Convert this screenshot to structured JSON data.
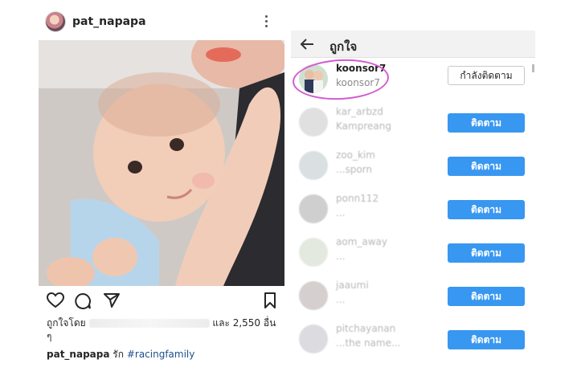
{
  "post": {
    "username": "pat_napapa",
    "likes_prefix": "ถูกใจโดย",
    "likes_suffix": "และ 2,550 อื่น",
    "likes_tail": "ๆ",
    "caption_user": "pat_napapa",
    "caption_text": "รัก",
    "caption_hashtag": "#racingfamily"
  },
  "likes_panel": {
    "title": "ถูกใจ",
    "rows": [
      {
        "username": "koonsor7",
        "subtitle": "koonsor7",
        "button": "กำลังติดตาม",
        "following": true
      },
      {
        "username": "kar_arbzd",
        "subtitle": "Kampreang",
        "button": "ติดตาม",
        "following": false
      },
      {
        "username": "zoo_kim",
        "subtitle": "...sporn",
        "button": "ติดตาม",
        "following": false
      },
      {
        "username": "ponn112",
        "subtitle": "...",
        "button": "ติดตาม",
        "following": false
      },
      {
        "username": "aom_away",
        "subtitle": "...",
        "button": "ติดตาม",
        "following": false
      },
      {
        "username": "jaaumi",
        "subtitle": "...",
        "button": "ติดตาม",
        "following": false
      },
      {
        "username": "pitchayanan",
        "subtitle": "...the name...",
        "button": "ติดตาม",
        "following": false
      }
    ]
  },
  "colors": {
    "follow_button": "#3897f0",
    "highlight_ring": "#d45bd0",
    "hashtag": "#1f4f8a"
  }
}
